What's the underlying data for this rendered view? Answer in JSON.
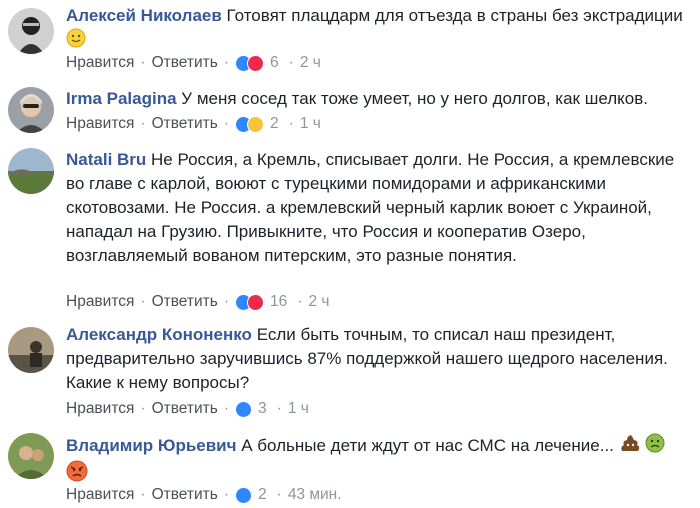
{
  "action_labels": {
    "like": "Нравится",
    "reply": "Ответить"
  },
  "comments": [
    {
      "author": "Алексей Николаев",
      "text": "Готовят плацдарм для отъезда в страны без экстрадиции",
      "reactions": [
        "like",
        "love"
      ],
      "count": "6",
      "time": "2 ч",
      "trailing_emoji": [
        "smile-emoji"
      ]
    },
    {
      "author": "Irma Palagina",
      "text": "У меня сосед так тоже умеет, но у него долгов, как шелков.",
      "reactions": [
        "like",
        "haha"
      ],
      "count": "2",
      "time": "1 ч"
    },
    {
      "author": "Natali Bru",
      "text": "Не Россия, а Кремль, списывает долги. Не Россия, а кремлевские во главе с карлой, воюют с турецкими помидорами и африканскими скотовозами. Не Россия. а кремлевский черный карлик воюет с Украиной, нападал на Грузию. Привыкните, что Россия и кооператив Озеро, возглавляемый вованом питерским, это разные понятия.",
      "reactions": [
        "like",
        "love"
      ],
      "count": "16",
      "time": "2 ч"
    },
    {
      "author": "Александр Кононенко",
      "text": "Если быть точным, то списал наш президент, предварительно заручившись 87% поддержкой нашего щедрого населения. Какие к нему вопросы?",
      "reactions": [
        "like"
      ],
      "count": "3",
      "time": "1 ч"
    },
    {
      "author": "Владимир Юрьевич",
      "text": "А больные дети ждут от нас СМС на лечение...",
      "reactions": [
        "like"
      ],
      "count": "2",
      "time": "43 мин.",
      "trailing_emoji": [
        "poop-emoji",
        "sick-emoji",
        "angry-emoji"
      ]
    }
  ]
}
